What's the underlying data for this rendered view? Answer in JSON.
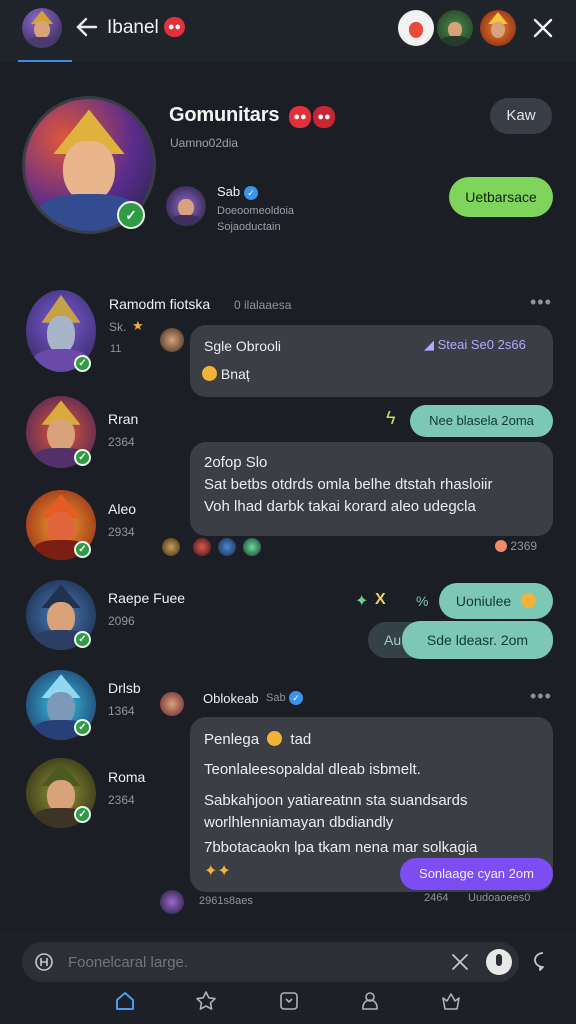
{
  "topbar": {
    "title": "Ibanel",
    "title_badge": "●●",
    "back_icon": "arrow-left-icon",
    "close_icon": "close-icon"
  },
  "header": {
    "title": "Gomunitars",
    "subtitle": "Uamno02dia",
    "badges": [
      "●●",
      "●●"
    ],
    "kaw_button": "Kaw",
    "owner_name": "Sab",
    "owner_line1": "Doeoomeoldoia",
    "owner_line2": "Sojaoductain",
    "green_button": "Uetbarsace"
  },
  "members": [
    {
      "name": "Ramodm fiotska",
      "meta": "Sk.",
      "meta2": "11"
    },
    {
      "name": "Rran",
      "meta": "2364"
    },
    {
      "name": "Aleo",
      "meta": "2934"
    },
    {
      "name": "Raepe Fuee",
      "meta": "2096"
    },
    {
      "name": "Drlsb",
      "meta": "1364"
    },
    {
      "name": "Roma",
      "meta": "2364"
    }
  ],
  "thread": {
    "header_time": "0 ilalaaesa",
    "msg1_title": "Sgle Obrooli",
    "msg1_tag": "Steai Se0 2s66",
    "msg1_line": "Bnaț",
    "pill1": "Nee blasela  2oma",
    "msg2_lines": [
      "2ofop Slo",
      "Sat betbs otdrds omla belhe dtstah rhasloiir",
      "Voh lhad darbk takai korard aleo udegcla"
    ],
    "reaction_count": "2369",
    "pill_right1": "Uoniulee",
    "pill_right2": "Sde ldeasr.  2om",
    "pill_right2_prefix": "Au",
    "react_marks": [
      "X",
      "%"
    ],
    "msg3_author": "Oblokeab",
    "msg3_author_meta": "Sab",
    "msg3_lines": [
      "Penlega",
      "Teonlaleesopaldal dleab isbmelt.",
      "Sabkahjoon yatiareatnn sta suandsards",
      "worlhlenniamayan dbdiandly",
      "7bbotacaokn lpa tkam nena mar solkagia"
    ],
    "msg3_line1_suffix": "tad",
    "pill_purple": "Sonlaage cyan 2om",
    "footer_left": "2961s8aes",
    "footer_mid": "2464",
    "footer_right": "Uudoaoees0"
  },
  "composer": {
    "placeholder": "Foonelcaral large.",
    "left_icon": "at-icon",
    "clear_icon": "close-icon",
    "mic_icon": "mic-icon",
    "bubble_icon": "chat-bubble-icon"
  },
  "nav": [
    "home-icon",
    "star-icon",
    "inbox-icon",
    "profile-icon",
    "trophy-icon"
  ],
  "colors": {
    "background": "#1b1e24",
    "bubble": "#3b3e45",
    "green": "#7fd45b",
    "teal": "#7cc8b4",
    "purple": "#7b4df2",
    "red": "#e2313a",
    "accent": "#3e8de0"
  }
}
